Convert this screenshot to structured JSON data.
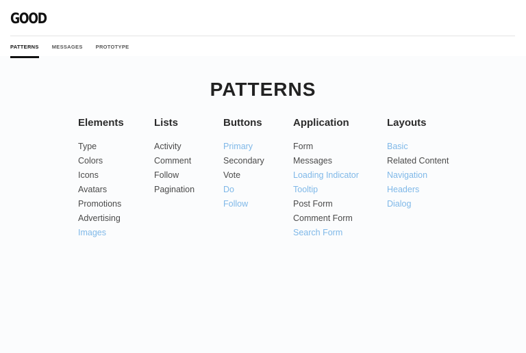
{
  "header": {
    "logo": "GOOD",
    "tabs": [
      {
        "label": "PATTERNS",
        "active": true
      },
      {
        "label": "MESSAGES",
        "active": false
      },
      {
        "label": "PROTOTYPE",
        "active": false
      }
    ]
  },
  "main": {
    "title": "PATTERNS",
    "columns": [
      {
        "heading": "Elements",
        "items": [
          {
            "label": "Type",
            "link": false
          },
          {
            "label": "Colors",
            "link": false
          },
          {
            "label": "Icons",
            "link": false
          },
          {
            "label": "Avatars",
            "link": false
          },
          {
            "label": "Promotions",
            "link": false
          },
          {
            "label": "Advertising",
            "link": false
          },
          {
            "label": "Images",
            "link": true
          }
        ]
      },
      {
        "heading": "Lists",
        "items": [
          {
            "label": "Activity",
            "link": false
          },
          {
            "label": "Comment",
            "link": false
          },
          {
            "label": "Follow",
            "link": false
          },
          {
            "label": "Pagination",
            "link": false
          }
        ]
      },
      {
        "heading": "Buttons",
        "items": [
          {
            "label": "Primary",
            "link": true
          },
          {
            "label": "Secondary",
            "link": false
          },
          {
            "label": "Vote",
            "link": false
          },
          {
            "label": "Do",
            "link": true
          },
          {
            "label": "Follow",
            "link": true
          }
        ]
      },
      {
        "heading": "Application",
        "items": [
          {
            "label": "Form",
            "link": false
          },
          {
            "label": "Messages",
            "link": false
          },
          {
            "label": "Loading Indicator",
            "link": true
          },
          {
            "label": "Tooltip",
            "link": true
          },
          {
            "label": "Post Form",
            "link": false
          },
          {
            "label": "Comment Form",
            "link": false
          },
          {
            "label": "Search Form",
            "link": true
          }
        ]
      },
      {
        "heading": "Layouts",
        "items": [
          {
            "label": "Basic",
            "link": true
          },
          {
            "label": "Related Content",
            "link": false
          },
          {
            "label": "Navigation",
            "link": true
          },
          {
            "label": "Headers",
            "link": true
          },
          {
            "label": "Dialog",
            "link": true
          }
        ]
      }
    ]
  }
}
